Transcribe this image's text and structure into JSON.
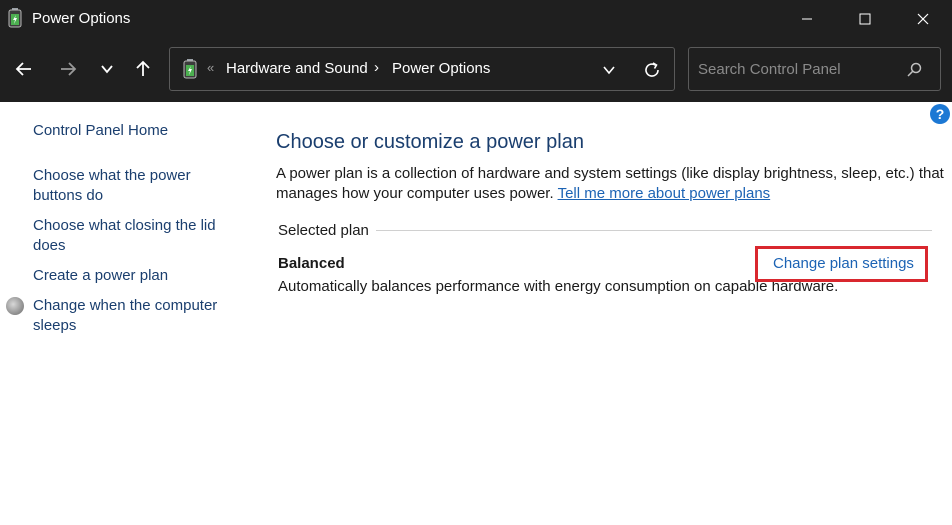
{
  "window": {
    "title": "Power Options",
    "controls": [
      "minimize-icon",
      "maximize-icon",
      "close-icon"
    ]
  },
  "nav": {
    "breadcrumb_prefix": "«",
    "breadcrumb": [
      "Hardware and Sound",
      "Power Options"
    ],
    "breadcrumb_separator": "›",
    "search_placeholder": "Search Control Panel"
  },
  "sidebar": {
    "home": "Control Panel Home",
    "links": [
      "Choose what the power buttons do",
      "Choose what closing the lid does",
      "Create a power plan",
      "Change when the computer sleeps"
    ]
  },
  "main": {
    "title": "Choose or customize a power plan",
    "description": "A power plan is a collection of hardware and system settings (like display brightness, sleep, etc.) that manages how your computer uses power.",
    "description_link": "Tell me more about power plans",
    "section_label": "Selected plan",
    "plan_name": "Balanced",
    "plan_description": "Automatically balances performance with energy consumption on capable hardware.",
    "change_link": "Change plan settings"
  },
  "help": {
    "glyph": "?"
  },
  "colors": {
    "titlebar_bg": "#1f1f1f",
    "link": "#1c63b4",
    "heading": "#1a3e6e",
    "highlight_box": "#d9272e",
    "help_bg": "#1c78d4"
  }
}
